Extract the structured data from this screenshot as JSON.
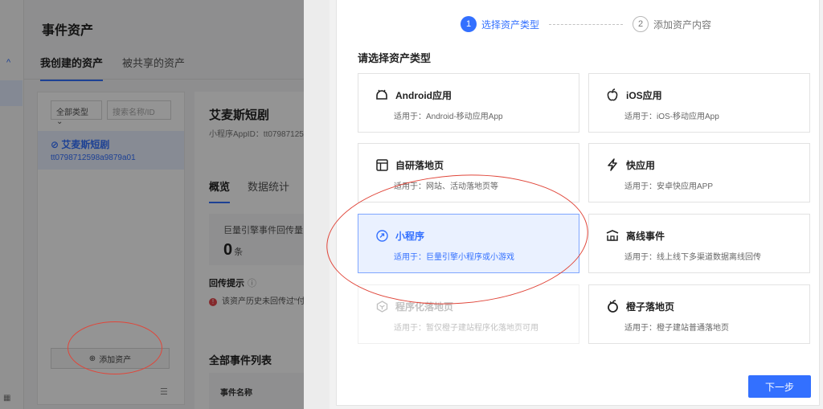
{
  "background_page": {
    "title": "事件资产",
    "tabs": [
      {
        "label": "我创建的资产",
        "active": true
      },
      {
        "label": "被共享的资产",
        "active": false
      }
    ],
    "filter": {
      "type_select": "全部类型",
      "search_placeholder": "搜索名称/ID"
    },
    "assets": [
      {
        "name": "艾麦斯短剧",
        "id": "tt0798712598a9879a01",
        "selected": true
      }
    ],
    "add_asset_label": "添加资产",
    "detail": {
      "name": "艾麦斯短剧",
      "appid": "小程序AppID：tt07987125",
      "tabs": [
        {
          "label": "概览",
          "active": true
        },
        {
          "label": "数据统计",
          "active": false
        }
      ],
      "stat_label": "巨量引擎事件回传量",
      "stat_value": "0",
      "stat_unit": "条",
      "hint_title": "回传提示",
      "hint_text": "该资产历史未回传过“付",
      "event_list_title": "全部事件列表",
      "event_col": "事件名称"
    }
  },
  "modal": {
    "steps": [
      {
        "num": "1",
        "label": "选择资产类型",
        "active": true
      },
      {
        "num": "2",
        "label": "添加资产内容",
        "active": false
      }
    ],
    "section_title": "请选择资产类型",
    "cards": [
      {
        "name": "Android应用",
        "desc": "适用于：Android-移动应用App",
        "icon": "android-icon",
        "state": "normal"
      },
      {
        "name": "iOS应用",
        "desc": "适用于：iOS-移动应用App",
        "icon": "apple-icon",
        "state": "normal"
      },
      {
        "name": "自研落地页",
        "desc": "适用于：网站、活动落地页等",
        "icon": "layout-icon",
        "state": "normal"
      },
      {
        "name": "快应用",
        "desc": "适用于：安卓快应用APP",
        "icon": "lightning-icon",
        "state": "normal"
      },
      {
        "name": "小程序",
        "desc": "适用于：巨量引擎小程序或小游戏",
        "icon": "link-icon",
        "state": "selected"
      },
      {
        "name": "离线事件",
        "desc": "适用于：线上线下多渠道数据离线回传",
        "icon": "offline-icon",
        "state": "normal"
      },
      {
        "name": "程序化落地页",
        "desc": "适用于：暂仅橙子建站程序化落地页可用",
        "icon": "cube-icon",
        "state": "disabled"
      },
      {
        "name": "橙子落地页",
        "desc": "适用于：橙子建站普通落地页",
        "icon": "orange-icon",
        "state": "normal"
      }
    ],
    "next_label": "下一步"
  },
  "colors": {
    "accent": "#3370ff",
    "annotation": "#e0463a",
    "selected_bg": "#eaf1ff"
  }
}
